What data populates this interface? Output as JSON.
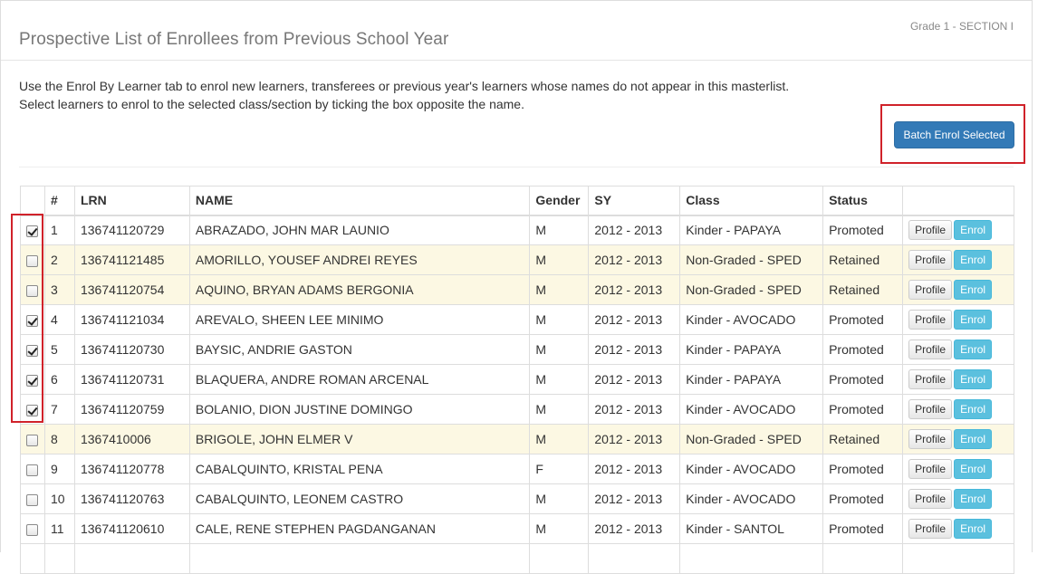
{
  "header": {
    "title": "Prospective List of Enrollees from Previous School Year",
    "section": "Grade 1 - SECTION I"
  },
  "instructions": {
    "line1": "Use the Enrol By Learner tab to enrol new learners, transferees or previous year's learners whose names do not appear in this masterlist.",
    "line2": "Select learners to enrol to the selected class/section by ticking the box opposite the name."
  },
  "batch_button_label": "Batch Enrol Selected",
  "table": {
    "columns": [
      "",
      "#",
      "LRN",
      "NAME",
      "Gender",
      "SY",
      "Class",
      "Status",
      ""
    ],
    "profile_label": "Profile",
    "enrol_label": "Enrol",
    "rows": [
      {
        "checked": true,
        "num": "1",
        "lrn": "136741120729",
        "name": "ABRAZADO, JOHN MAR LAUNIO",
        "gender": "M",
        "sy": "2012 - 2013",
        "class": "Kinder - PAPAYA",
        "status": "Promoted"
      },
      {
        "checked": false,
        "num": "2",
        "lrn": "136741121485",
        "name": "AMORILLO, YOUSEF ANDREI REYES",
        "gender": "M",
        "sy": "2012 - 2013",
        "class": "Non-Graded - SPED",
        "status": "Retained"
      },
      {
        "checked": false,
        "num": "3",
        "lrn": "136741120754",
        "name": "AQUINO, BRYAN ADAMS BERGONIA",
        "gender": "M",
        "sy": "2012 - 2013",
        "class": "Non-Graded - SPED",
        "status": "Retained"
      },
      {
        "checked": true,
        "num": "4",
        "lrn": "136741121034",
        "name": "AREVALO, SHEEN LEE MINIMO",
        "gender": "M",
        "sy": "2012 - 2013",
        "class": "Kinder - AVOCADO",
        "status": "Promoted"
      },
      {
        "checked": true,
        "num": "5",
        "lrn": "136741120730",
        "name": "BAYSIC, ANDRIE GASTON",
        "gender": "M",
        "sy": "2012 - 2013",
        "class": "Kinder - PAPAYA",
        "status": "Promoted"
      },
      {
        "checked": true,
        "num": "6",
        "lrn": "136741120731",
        "name": "BLAQUERA, ANDRE ROMAN ARCENAL",
        "gender": "M",
        "sy": "2012 - 2013",
        "class": "Kinder - PAPAYA",
        "status": "Promoted"
      },
      {
        "checked": true,
        "num": "7",
        "lrn": "136741120759",
        "name": "BOLANIO, DION JUSTINE DOMINGO",
        "gender": "M",
        "sy": "2012 - 2013",
        "class": "Kinder - AVOCADO",
        "status": "Promoted"
      },
      {
        "checked": false,
        "num": "8",
        "lrn": "1367410006",
        "name": "BRIGOLE, JOHN ELMER V",
        "gender": "M",
        "sy": "2012 - 2013",
        "class": "Non-Graded - SPED",
        "status": "Retained"
      },
      {
        "checked": false,
        "num": "9",
        "lrn": "136741120778",
        "name": "CABALQUINTO, KRISTAL PENA",
        "gender": "F",
        "sy": "2012 - 2013",
        "class": "Kinder - AVOCADO",
        "status": "Promoted"
      },
      {
        "checked": false,
        "num": "10",
        "lrn": "136741120763",
        "name": "CABALQUINTO, LEONEM CASTRO",
        "gender": "M",
        "sy": "2012 - 2013",
        "class": "Kinder - AVOCADO",
        "status": "Promoted"
      },
      {
        "checked": false,
        "num": "11",
        "lrn": "136741120610",
        "name": "CALE, RENE STEPHEN PAGDANGANAN",
        "gender": "M",
        "sy": "2012 - 2013",
        "class": "Kinder - SANTOL",
        "status": "Promoted"
      },
      {
        "checked": false,
        "num": "",
        "lrn": "",
        "name": "",
        "gender": "",
        "sy": "",
        "class": "",
        "status": ""
      }
    ]
  },
  "colors": {
    "primary": "#337ab7",
    "info": "#5bc0de",
    "highlight_border": "#d0222a",
    "retained_row": "#fcf8e3"
  }
}
